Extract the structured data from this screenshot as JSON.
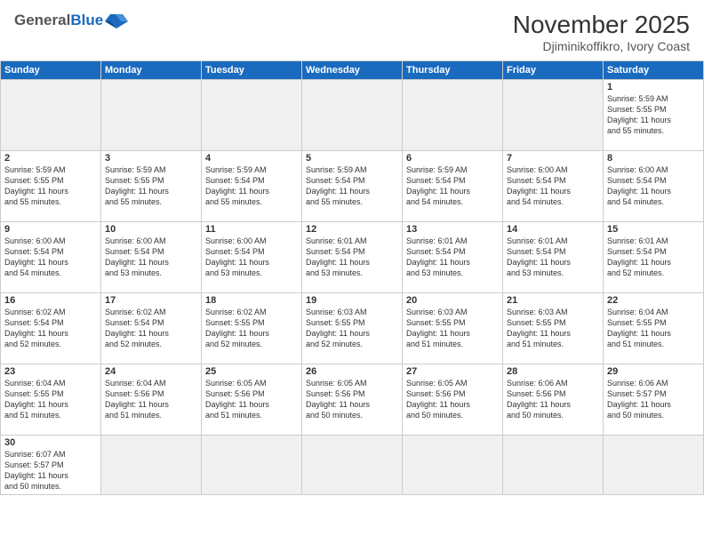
{
  "header": {
    "logo_general": "General",
    "logo_blue": "Blue",
    "month_year": "November 2025",
    "location": "Djiminikoffikro, Ivory Coast"
  },
  "days_of_week": [
    "Sunday",
    "Monday",
    "Tuesday",
    "Wednesday",
    "Thursday",
    "Friday",
    "Saturday"
  ],
  "weeks": [
    [
      {
        "day": "",
        "info": ""
      },
      {
        "day": "",
        "info": ""
      },
      {
        "day": "",
        "info": ""
      },
      {
        "day": "",
        "info": ""
      },
      {
        "day": "",
        "info": ""
      },
      {
        "day": "",
        "info": ""
      },
      {
        "day": "1",
        "info": "Sunrise: 5:59 AM\nSunset: 5:55 PM\nDaylight: 11 hours\nand 55 minutes."
      }
    ],
    [
      {
        "day": "2",
        "info": "Sunrise: 5:59 AM\nSunset: 5:55 PM\nDaylight: 11 hours\nand 55 minutes."
      },
      {
        "day": "3",
        "info": "Sunrise: 5:59 AM\nSunset: 5:55 PM\nDaylight: 11 hours\nand 55 minutes."
      },
      {
        "day": "4",
        "info": "Sunrise: 5:59 AM\nSunset: 5:54 PM\nDaylight: 11 hours\nand 55 minutes."
      },
      {
        "day": "5",
        "info": "Sunrise: 5:59 AM\nSunset: 5:54 PM\nDaylight: 11 hours\nand 55 minutes."
      },
      {
        "day": "6",
        "info": "Sunrise: 5:59 AM\nSunset: 5:54 PM\nDaylight: 11 hours\nand 54 minutes."
      },
      {
        "day": "7",
        "info": "Sunrise: 6:00 AM\nSunset: 5:54 PM\nDaylight: 11 hours\nand 54 minutes."
      },
      {
        "day": "8",
        "info": "Sunrise: 6:00 AM\nSunset: 5:54 PM\nDaylight: 11 hours\nand 54 minutes."
      }
    ],
    [
      {
        "day": "9",
        "info": "Sunrise: 6:00 AM\nSunset: 5:54 PM\nDaylight: 11 hours\nand 54 minutes."
      },
      {
        "day": "10",
        "info": "Sunrise: 6:00 AM\nSunset: 5:54 PM\nDaylight: 11 hours\nand 53 minutes."
      },
      {
        "day": "11",
        "info": "Sunrise: 6:00 AM\nSunset: 5:54 PM\nDaylight: 11 hours\nand 53 minutes."
      },
      {
        "day": "12",
        "info": "Sunrise: 6:01 AM\nSunset: 5:54 PM\nDaylight: 11 hours\nand 53 minutes."
      },
      {
        "day": "13",
        "info": "Sunrise: 6:01 AM\nSunset: 5:54 PM\nDaylight: 11 hours\nand 53 minutes."
      },
      {
        "day": "14",
        "info": "Sunrise: 6:01 AM\nSunset: 5:54 PM\nDaylight: 11 hours\nand 53 minutes."
      },
      {
        "day": "15",
        "info": "Sunrise: 6:01 AM\nSunset: 5:54 PM\nDaylight: 11 hours\nand 52 minutes."
      }
    ],
    [
      {
        "day": "16",
        "info": "Sunrise: 6:02 AM\nSunset: 5:54 PM\nDaylight: 11 hours\nand 52 minutes."
      },
      {
        "day": "17",
        "info": "Sunrise: 6:02 AM\nSunset: 5:54 PM\nDaylight: 11 hours\nand 52 minutes."
      },
      {
        "day": "18",
        "info": "Sunrise: 6:02 AM\nSunset: 5:55 PM\nDaylight: 11 hours\nand 52 minutes."
      },
      {
        "day": "19",
        "info": "Sunrise: 6:03 AM\nSunset: 5:55 PM\nDaylight: 11 hours\nand 52 minutes."
      },
      {
        "day": "20",
        "info": "Sunrise: 6:03 AM\nSunset: 5:55 PM\nDaylight: 11 hours\nand 51 minutes."
      },
      {
        "day": "21",
        "info": "Sunrise: 6:03 AM\nSunset: 5:55 PM\nDaylight: 11 hours\nand 51 minutes."
      },
      {
        "day": "22",
        "info": "Sunrise: 6:04 AM\nSunset: 5:55 PM\nDaylight: 11 hours\nand 51 minutes."
      }
    ],
    [
      {
        "day": "23",
        "info": "Sunrise: 6:04 AM\nSunset: 5:55 PM\nDaylight: 11 hours\nand 51 minutes."
      },
      {
        "day": "24",
        "info": "Sunrise: 6:04 AM\nSunset: 5:56 PM\nDaylight: 11 hours\nand 51 minutes."
      },
      {
        "day": "25",
        "info": "Sunrise: 6:05 AM\nSunset: 5:56 PM\nDaylight: 11 hours\nand 51 minutes."
      },
      {
        "day": "26",
        "info": "Sunrise: 6:05 AM\nSunset: 5:56 PM\nDaylight: 11 hours\nand 50 minutes."
      },
      {
        "day": "27",
        "info": "Sunrise: 6:05 AM\nSunset: 5:56 PM\nDaylight: 11 hours\nand 50 minutes."
      },
      {
        "day": "28",
        "info": "Sunrise: 6:06 AM\nSunset: 5:56 PM\nDaylight: 11 hours\nand 50 minutes."
      },
      {
        "day": "29",
        "info": "Sunrise: 6:06 AM\nSunset: 5:57 PM\nDaylight: 11 hours\nand 50 minutes."
      }
    ],
    [
      {
        "day": "30",
        "info": "Sunrise: 6:07 AM\nSunset: 5:57 PM\nDaylight: 11 hours\nand 50 minutes."
      },
      {
        "day": "",
        "info": ""
      },
      {
        "day": "",
        "info": ""
      },
      {
        "day": "",
        "info": ""
      },
      {
        "day": "",
        "info": ""
      },
      {
        "day": "",
        "info": ""
      },
      {
        "day": "",
        "info": ""
      }
    ]
  ]
}
